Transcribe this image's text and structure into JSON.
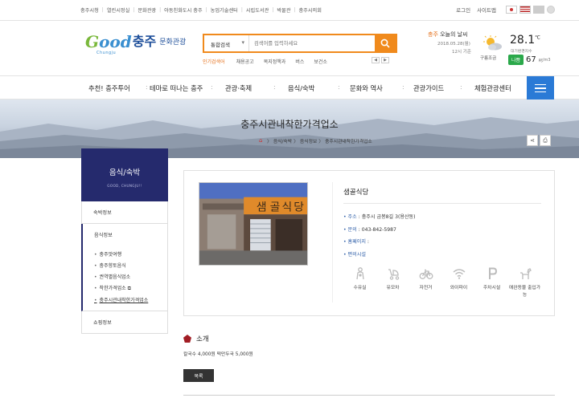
{
  "util": {
    "links": [
      "충주시청",
      "열린시정실",
      "문화관광",
      "아동친화도시 충주",
      "농업기술센터",
      "시립도서관",
      "박물관",
      "충주시의회"
    ],
    "login": "로그인",
    "sitemap": "사이트맵"
  },
  "logo": {
    "good_g": "G",
    "good_rest": "ood",
    "city": "충주",
    "culture": "문화관광",
    "sub": "Chungju"
  },
  "search": {
    "scope": "통합검색",
    "placeholder": "검색어를 입력하세요",
    "popular_label": "인기검색어",
    "keywords": [
      "채용공고",
      "복지정책과",
      "버스",
      "보건소"
    ],
    "prev": "◀",
    "next": "▶"
  },
  "weather": {
    "city": "충주",
    "title_rest": " 오늘의 날씨",
    "date": "2018.05.28(월)",
    "time": "12시 기준",
    "condition": "구름조금",
    "temp": "28.1",
    "temp_unit": "℃",
    "temp_label": "대기환경지수",
    "aq_badge": "나쁨",
    "aq_value": "67",
    "aq_unit": "㎍/m3",
    "colors": {
      "accent": "#e5701b",
      "badge": "#2aa84a"
    }
  },
  "gnb": {
    "items": [
      "추천! 충주투어",
      "테마로 떠나는 충주",
      "관광·축제",
      "음식/숙박",
      "문화와 역사",
      "관광가이드",
      "체험관광센터"
    ],
    "menu_icon": "hamburger-icon"
  },
  "banner": {
    "title": "충주시관내착한가격업소",
    "crumbs": [
      "음식/숙박",
      "음식정보",
      "충주시관내착한가격업소"
    ],
    "crumb_sep": "〉"
  },
  "lnb": {
    "title": "음식/숙박",
    "subtitle": "GOOD, CHUNGJU!!",
    "groups": [
      {
        "label": "숙박정보"
      },
      {
        "label": "음식정보",
        "subs": [
          "충주맛여행",
          "충주향토음식",
          "권역별음식업소",
          "착한가격업소",
          "충주시관내착한가격업소"
        ]
      },
      {
        "label": "쇼핑정보"
      }
    ],
    "external_icon": "external-link-icon"
  },
  "shop": {
    "name": "샘골식당",
    "info": [
      {
        "key": "주소",
        "value": "충주시 금봉8길 3(용산동)"
      },
      {
        "key": "문의",
        "value": "043-842-5987"
      },
      {
        "key": "홈페이지",
        "value": ""
      },
      {
        "key": "편의시설",
        "value": ""
      }
    ],
    "info_sep": " : ",
    "facilities": [
      {
        "icon": "nursing-room-icon",
        "label": "수유실"
      },
      {
        "icon": "stroller-icon",
        "label": "유모차"
      },
      {
        "icon": "bicycle-icon",
        "label": "자전거"
      },
      {
        "icon": "wifi-icon",
        "label": "와이파이"
      },
      {
        "icon": "parking-icon",
        "label": "주차시설"
      },
      {
        "icon": "pet-icon",
        "label": "애완동물 출입가능"
      }
    ],
    "photo_signs": {
      "sign1": "샘",
      "sign2": "골",
      "sign3": "식",
      "sign4": "당"
    }
  },
  "intro": {
    "title": "소개",
    "desc": "칼국수 4,000원 떡만두국 5,000원",
    "list_button": "목록"
  }
}
